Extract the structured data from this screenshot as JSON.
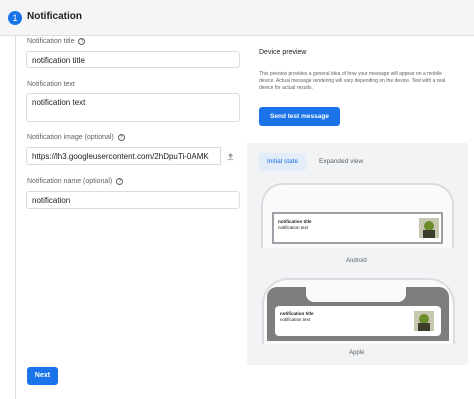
{
  "header": {
    "step_number": "1",
    "title": "Notification"
  },
  "form": {
    "title_label": "Notification title",
    "title_value": "notification title",
    "text_label": "Notification text",
    "text_value": "notification text",
    "image_label": "Notification image (optional)",
    "image_value": "https://lh3.googleusercontent.com/2hDpuTi-0AMK",
    "name_label": "Notification name (optional)",
    "name_value": "notification",
    "help_glyph": "?"
  },
  "next_button": "Next",
  "preview": {
    "title": "Device preview",
    "description": "This preview provides a general idea of how your message will appear on a mobile device. Actual message rendering will vary depending on the device. Test with a real device for actual results.",
    "send_button": "Send test message",
    "tabs": [
      "Initial state",
      "Expanded view"
    ],
    "android_label": "Android",
    "apple_label": "Apple",
    "notif_title": "notification title",
    "notif_text": "notification text"
  },
  "colors": {
    "accent": "#1a73e8",
    "tab_active_bg": "#e3ecf9"
  }
}
